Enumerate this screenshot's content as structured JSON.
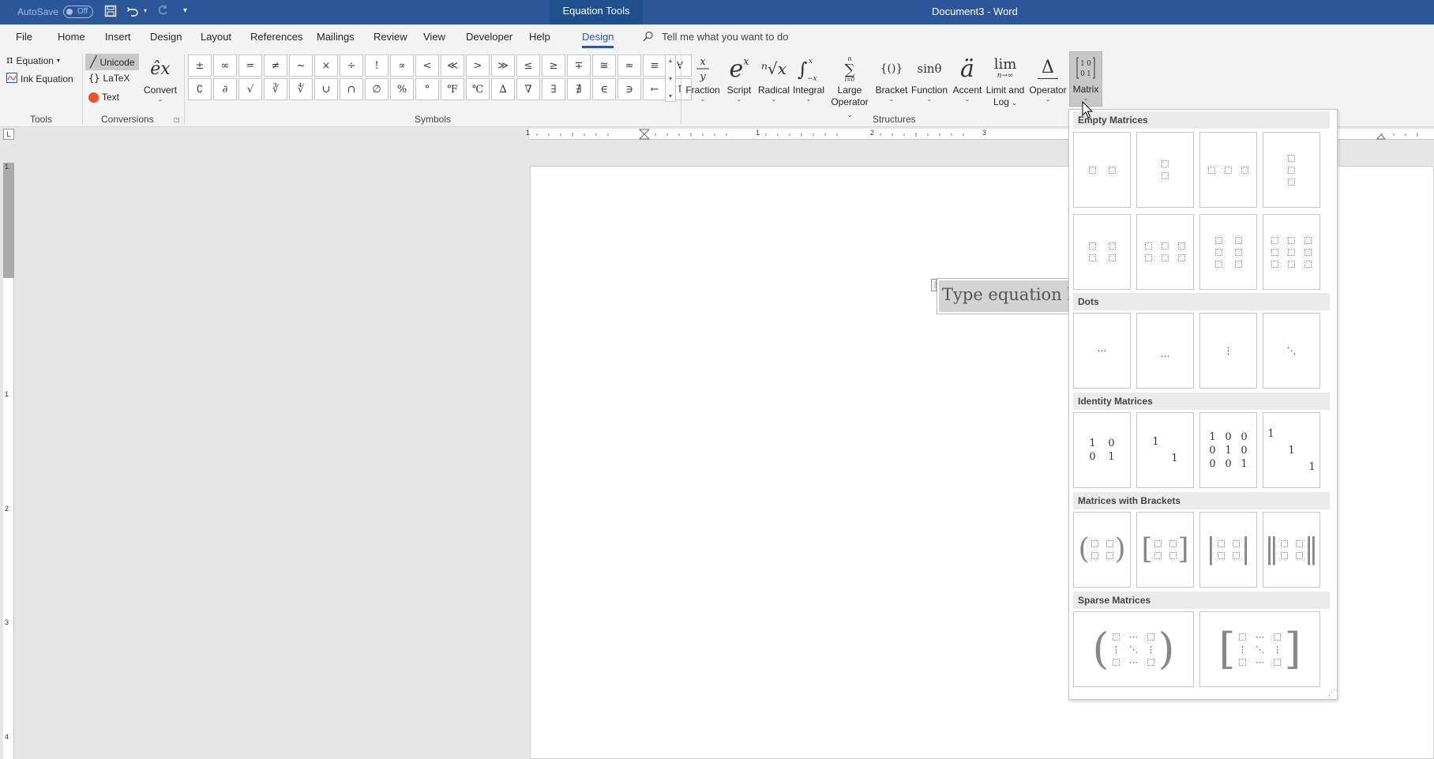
{
  "titlebar": {
    "autosave_label": "AutoSave",
    "autosave_state": "Off",
    "contextual_tab": "Equation Tools",
    "document_title": "Document3  -  Word"
  },
  "tabs": [
    {
      "label": "File"
    },
    {
      "label": "Home"
    },
    {
      "label": "Insert"
    },
    {
      "label": "Design"
    },
    {
      "label": "Layout"
    },
    {
      "label": "References"
    },
    {
      "label": "Mailings"
    },
    {
      "label": "Review"
    },
    {
      "label": "View"
    },
    {
      "label": "Developer"
    },
    {
      "label": "Help"
    },
    {
      "label": "Design"
    }
  ],
  "tell_me": "Tell me what you want to do",
  "ribbon": {
    "tools": {
      "equation": "Equation",
      "ink_equation": "Ink Equation",
      "label": "Tools"
    },
    "conversions": {
      "unicode": "Unicode",
      "latex": "LaTeX",
      "text": "Text",
      "convert": "Convert",
      "label": "Conversions"
    },
    "symbols": {
      "label": "Symbols",
      "row1": [
        "±",
        "∞",
        "=",
        "≠",
        "~",
        "×",
        "÷",
        "!",
        "∝",
        "<",
        "≪",
        ">",
        "≫",
        "≤",
        "≥",
        "∓",
        "≅",
        "≈",
        "≡",
        "∀"
      ],
      "row2": [
        "∁",
        "∂",
        "√",
        "∛",
        "∜",
        "∪",
        "∩",
        "∅",
        "%",
        "°",
        "℉",
        "℃",
        "∆",
        "∇",
        "∃",
        "∄",
        "∈",
        "∋",
        "←",
        "↑"
      ]
    },
    "structures": {
      "label": "Structures",
      "fraction": "Fraction",
      "script": "Script",
      "radical": "Radical",
      "integral": "Integral",
      "large_operator_1": "Large",
      "large_operator_2": "Operator",
      "bracket": "Bracket",
      "function": "Function",
      "accent": "Accent",
      "limit_1": "Limit and",
      "limit_2": "Log",
      "operator": "Operator",
      "matrix": "Matrix",
      "glyph_script": "e",
      "glyph_script_sup": "x",
      "glyph_radical": "ⁿ√x",
      "glyph_bracket": "{()}",
      "glyph_function": "sinθ",
      "glyph_accent": "ä",
      "glyph_limit": "lim",
      "glyph_limit_sub": "n→∞",
      "glyph_operator": "Δ"
    }
  },
  "ruler": {
    "h_numbers": [
      "1",
      "1",
      "2",
      "3"
    ],
    "v_numbers": [
      "1",
      "1",
      "2",
      "3",
      "4"
    ]
  },
  "document": {
    "equation_placeholder": "Type equation here."
  },
  "matrix_menu": {
    "sections": {
      "empty": "Empty Matrices",
      "dots": "Dots",
      "identity": "Identity Matrices",
      "brackets": "Matrices with Brackets",
      "sparse": "Sparse Matrices"
    },
    "dots": [
      "⋯",
      "…",
      "⋮",
      "⋱"
    ],
    "identity_2x2": [
      "1",
      "0",
      "0",
      "1"
    ],
    "identity_2x2_sparse": [
      "1",
      "1"
    ],
    "identity_3x3": [
      "1",
      "0",
      "0",
      "0",
      "1",
      "0",
      "0",
      "0",
      "1"
    ],
    "identity_3x3_sparse": [
      "1",
      "1",
      "1"
    ],
    "brackets": [
      "(",
      ")",
      "[",
      "]",
      "|",
      "|",
      "‖",
      "‖"
    ]
  },
  "colors": {
    "titlebar": "#2b579a",
    "accent": "#2b579a",
    "text_dot": "#f25022"
  }
}
